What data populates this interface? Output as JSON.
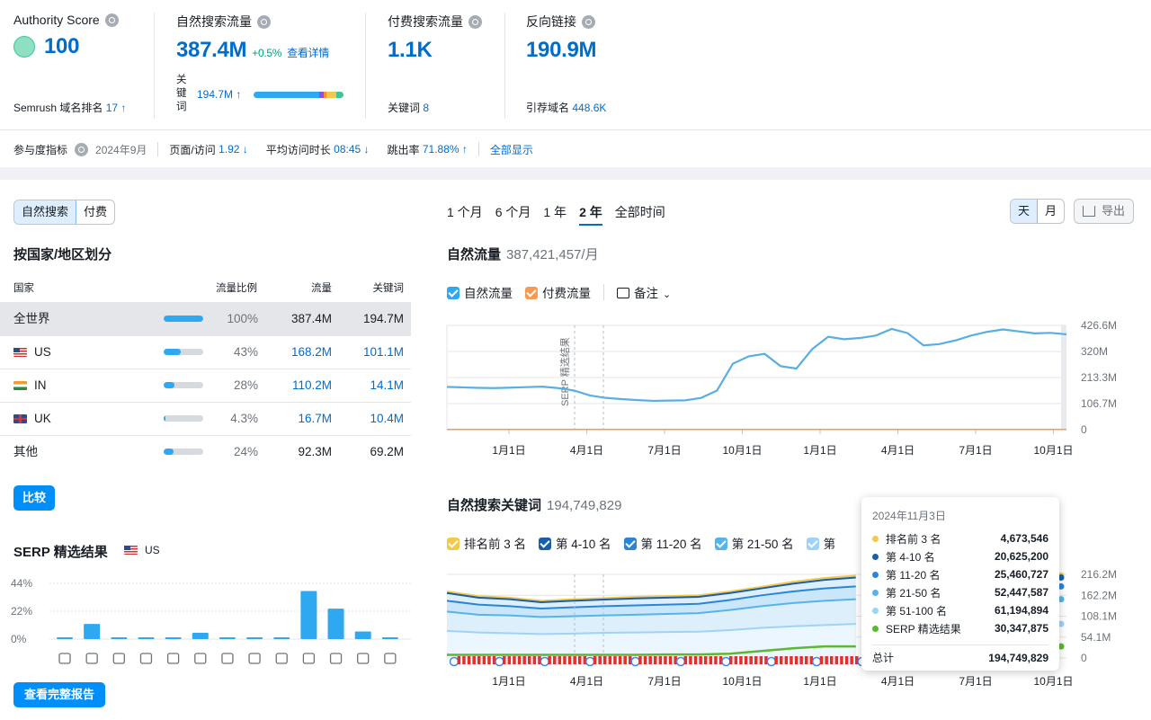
{
  "metrics": {
    "authority": {
      "title": "Authority Score",
      "value": "100",
      "sub_label": "Semrush 域名排名",
      "sub_value": "17 ↑"
    },
    "organic": {
      "title": "自然搜索流量",
      "value": "387.4M",
      "change": "+0.5%",
      "details_link": "查看详情",
      "kw_label": "关\n键\n词",
      "kw_value": "194.7M ↑"
    },
    "paid": {
      "title": "付费搜索流量",
      "value": "1.1K",
      "sub_label": "关键词",
      "sub_value": "8"
    },
    "backlinks": {
      "title": "反向链接",
      "value": "190.9M",
      "sub_label": "引荐域名",
      "sub_value": "448.6K"
    }
  },
  "engagement": {
    "label": "参与度指标",
    "date": "2024年9月",
    "pages_label": "页面/访问",
    "pages_value": "1.92 ↓",
    "duration_label": "平均访问时长",
    "duration_value": "08:45 ↓",
    "bounce_label": "跳出率",
    "bounce_value": "71.88% ↑",
    "show_all": "全部显示"
  },
  "left": {
    "tabs": [
      "自然搜索",
      "付费"
    ],
    "section_title": "按国家/地区划分",
    "columns": [
      "国家",
      "流量比例",
      "流量",
      "关键词"
    ],
    "rows": [
      {
        "country": "全世界",
        "flag": "",
        "share": "100%",
        "share_num": 100,
        "traffic": "387.4M",
        "keywords": "194.7M"
      },
      {
        "country": "US",
        "flag": "us",
        "share": "43%",
        "share_num": 43,
        "traffic": "168.2M",
        "keywords": "101.1M"
      },
      {
        "country": "IN",
        "flag": "in",
        "share": "28%",
        "share_num": 28,
        "traffic": "110.2M",
        "keywords": "14.1M"
      },
      {
        "country": "UK",
        "flag": "uk",
        "share": "4.3%",
        "share_num": 4.3,
        "traffic": "16.7M",
        "keywords": "10.4M"
      },
      {
        "country": "其他",
        "flag": "",
        "share": "24%",
        "share_num": 24,
        "traffic": "92.3M",
        "keywords": "69.2M"
      }
    ],
    "compare_button": "比较",
    "serp_title": "SERP 精选结果",
    "serp_country": "US",
    "report_button": "查看完整报告"
  },
  "right": {
    "periods": [
      "1 个月",
      "6 个月",
      "1 年",
      "2 年",
      "全部时间"
    ],
    "active_period": "2 年",
    "day_month": [
      "天",
      "月"
    ],
    "export_label": "导出",
    "traffic_title": "自然流量",
    "traffic_value": "387,421,457/月",
    "traffic_legend": [
      "自然流量",
      "付费流量"
    ],
    "notes_label": "备注",
    "serp_annotation": "SERP 精选结果",
    "kw_title": "自然搜索关键词",
    "kw_value": "194,749,829",
    "kw_legend": [
      "排名前 3 名",
      "第 4-10 名",
      "第 11-20 名",
      "第 21-50 名",
      "第"
    ]
  },
  "tooltip": {
    "date": "2024年11月3日",
    "rows": [
      {
        "label": "排名前 3 名",
        "value": "4,673,546",
        "color": "#f2c94c"
      },
      {
        "label": "第 4-10 名",
        "value": "20,625,200",
        "color": "#1a5ea8"
      },
      {
        "label": "第 11-20 名",
        "value": "25,460,727",
        "color": "#2a86d4"
      },
      {
        "label": "第 21-50 名",
        "value": "52,447,587",
        "color": "#58b3ea"
      },
      {
        "label": "第 51-100 名",
        "value": "61,194,894",
        "color": "#9fd3f5"
      },
      {
        "label": "SERP 精选结果",
        "value": "30,347,875",
        "color": "#5cb82e"
      }
    ],
    "total_label": "总计",
    "total_value": "194,749,829"
  },
  "colors": {
    "accent": "#006dca",
    "bar": "#2ea8f0",
    "organic_line": "#5aaee0",
    "paid_line": "#f49a52"
  },
  "chart_data": [
    {
      "type": "line",
      "x_ticks": [
        "1月1日",
        "4月1日",
        "7月1日",
        "10月1日",
        "1月1日",
        "4月1日",
        "7月1日",
        "10月1日"
      ],
      "y_ticks": [
        "426.6M",
        "320M",
        "213.3M",
        "106.7M",
        "0"
      ],
      "ylim": [
        0,
        426.6
      ],
      "series": [
        {
          "name": "自然流量",
          "values": [
            175,
            173,
            171,
            170,
            172,
            174,
            176,
            170,
            160,
            140,
            130,
            125,
            121,
            118,
            119,
            120,
            130,
            160,
            270,
            300,
            310,
            260,
            250,
            330,
            380,
            370,
            375,
            385,
            412,
            395,
            345,
            350,
            365,
            385,
            400,
            410,
            402,
            394,
            396,
            390
          ]
        },
        {
          "name": "付费流量",
          "values": [
            1,
            1,
            1,
            1,
            1,
            1,
            1,
            1,
            1,
            1,
            1,
            1,
            1,
            1,
            1,
            1,
            1,
            1,
            1,
            1,
            1,
            1,
            1,
            1,
            1,
            1,
            1,
            1,
            1,
            1,
            1,
            1,
            1,
            1,
            1,
            1,
            1,
            1,
            1,
            1
          ]
        }
      ]
    },
    {
      "type": "area",
      "x_ticks": [
        "1月1日",
        "4月1日",
        "7月1日",
        "10月1日",
        "1月1日",
        "4月1日",
        "7月1日",
        "10月1日"
      ],
      "y_ticks": [
        "216.2M",
        "162.2M",
        "108.1M",
        "54.1M",
        "0"
      ],
      "ylim": [
        0,
        216.2
      ],
      "series": [
        {
          "name": "排名前 3 名",
          "values": [
            172,
            160,
            156,
            148,
            152,
            155,
            158,
            160,
            162,
            172,
            184,
            197,
            207,
            213
          ]
        },
        {
          "name": "第 4-10 名",
          "values": [
            168,
            156,
            152,
            144,
            148,
            151,
            154,
            156,
            158,
            168,
            180,
            192,
            202,
            208
          ]
        },
        {
          "name": "第 11-20 名",
          "values": [
            148,
            138,
            134,
            128,
            131,
            134,
            136,
            138,
            140,
            150,
            162,
            172,
            180,
            185
          ]
        },
        {
          "name": "第 21-50 名",
          "values": [
            120,
            112,
            110,
            106,
            108,
            110,
            112,
            114,
            116,
            124,
            134,
            142,
            148,
            152
          ]
        },
        {
          "name": "第 51-100 名",
          "values": [
            70,
            66,
            64,
            62,
            63,
            65,
            66,
            67,
            68,
            72,
            78,
            82,
            85,
            88
          ]
        },
        {
          "name": "SERP 精选结果",
          "values": [
            8,
            8,
            8,
            8,
            8,
            8,
            8,
            9,
            9,
            11,
            18,
            25,
            30,
            30
          ]
        }
      ]
    },
    {
      "type": "bar",
      "y_ticks": [
        "44%",
        "22%",
        "0%"
      ],
      "ylim": [
        0,
        44
      ],
      "values": [
        1,
        12,
        1,
        1,
        1,
        5,
        1,
        1,
        1,
        38,
        24,
        6,
        1
      ]
    }
  ]
}
